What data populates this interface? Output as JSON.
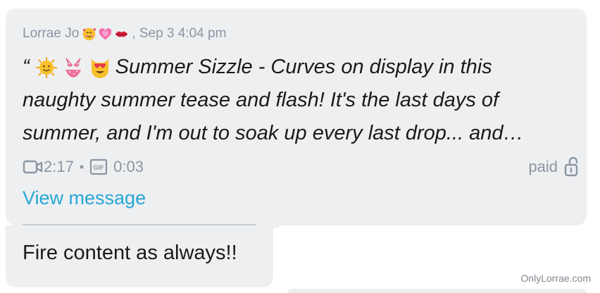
{
  "message": {
    "sender": "Lorrae Jo",
    "sender_emojis": [
      "smiling-face-with-hearts",
      "growing-heart",
      "kiss-mark"
    ],
    "timestamp": ", Sep 3 4:04 pm",
    "quote_mark": "“",
    "preview_emojis": [
      "sun-with-face",
      "bikini",
      "smiling-cat-heart-eyes"
    ],
    "line1": "Summer Sizzle - Curves on display in this",
    "line2": "naughty summer tease and flash! It's the last days of",
    "line3": "summer, and I'm out to soak up every last drop... and…",
    "video_duration": "2:17",
    "stat_separator": "•",
    "gif_duration": "0:03",
    "paid_label": "paid",
    "view_label": "View message"
  },
  "reply": {
    "text": "Fire content as always!!"
  },
  "watermark": "OnlyLorrae.com",
  "colors": {
    "bubble": "#eeeff1",
    "meta": "#8a96a3",
    "link": "#27a7d4",
    "text": "#1a1a1a"
  }
}
